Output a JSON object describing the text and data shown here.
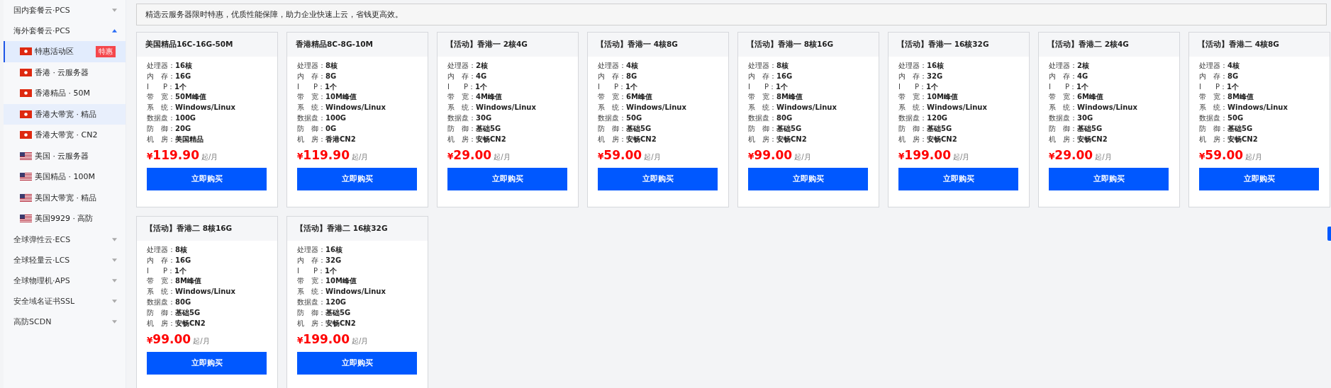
{
  "sidebar": {
    "groups": [
      {
        "label": "国内套餐云·PCS",
        "expanded": false
      },
      {
        "label": "海外套餐云·PCS",
        "expanded": true,
        "items": [
          {
            "label": "特惠活动区",
            "kind": "hk",
            "selected": true,
            "hovered": false,
            "badge": "特惠"
          },
          {
            "label": "香港 · 云服务器",
            "kind": "hk",
            "selected": false,
            "hovered": false
          },
          {
            "label": "香港精品 · 50M",
            "kind": "hk",
            "selected": false,
            "hovered": false
          },
          {
            "label": "香港大带宽 · 精品",
            "kind": "hk",
            "selected": false,
            "hovered": true
          },
          {
            "label": "香港大带宽 · CN2",
            "kind": "hk",
            "selected": false,
            "hovered": false
          },
          {
            "label": "美国 · 云服务器",
            "kind": "us",
            "selected": false,
            "hovered": false
          },
          {
            "label": "美国精品 · 100M",
            "kind": "us",
            "selected": false,
            "hovered": false
          },
          {
            "label": "美国大带宽 · 精品",
            "kind": "us",
            "selected": false,
            "hovered": false
          },
          {
            "label": "美国9929 · 高防",
            "kind": "us",
            "selected": false,
            "hovered": false
          }
        ]
      },
      {
        "label": "全球弹性云·ECS",
        "expanded": false
      },
      {
        "label": "全球轻量云·LCS",
        "expanded": false
      },
      {
        "label": "全球物理机·APS",
        "expanded": false
      },
      {
        "label": "安全域名证书SSL",
        "expanded": false
      },
      {
        "label": "高防SCDN",
        "expanded": false
      }
    ]
  },
  "notice": "精选云服务器限时特惠，优质性能保障，助力企业快速上云，省钱更高效。",
  "products": [
    {
      "title": "美国精品16C-16G-50M",
      "specs": [
        {
          "label": "处理器：",
          "value": "16核"
        },
        {
          "label": "内　存：",
          "value": "16G"
        },
        {
          "label": "I　　P：",
          "value": "1个"
        },
        {
          "label": "带　宽：",
          "value": "50M峰值"
        },
        {
          "label": "系　统：",
          "value": "Windows/Linux"
        },
        {
          "label": "数据盘：",
          "value": "100G"
        },
        {
          "label": "防　御：",
          "value": "20G"
        },
        {
          "label": "机　房：",
          "value": "美国精品"
        }
      ],
      "currency": "¥",
      "price": "119.90",
      "unit": "起/月",
      "button": "立即购买"
    },
    {
      "title": "香港精品8C-8G-10M",
      "specs": [
        {
          "label": "处理器：",
          "value": "8核"
        },
        {
          "label": "内　存：",
          "value": "8G"
        },
        {
          "label": "I　　P：",
          "value": "1个"
        },
        {
          "label": "带　宽：",
          "value": "10M峰值"
        },
        {
          "label": "系　统：",
          "value": "Windows/Linux"
        },
        {
          "label": "数据盘：",
          "value": "100G"
        },
        {
          "label": "防　御：",
          "value": "0G"
        },
        {
          "label": "机　房：",
          "value": "香港CN2"
        }
      ],
      "currency": "¥",
      "price": "119.90",
      "unit": "起/月",
      "button": "立即购买"
    },
    {
      "title": "【活动】香港一 2核4G",
      "specs": [
        {
          "label": "处理器：",
          "value": "2核"
        },
        {
          "label": "内　存：",
          "value": "4G"
        },
        {
          "label": "I　　P：",
          "value": "1个"
        },
        {
          "label": "带　宽：",
          "value": "4M峰值"
        },
        {
          "label": "系　统：",
          "value": "Windows/Linux"
        },
        {
          "label": "数据盘：",
          "value": "30G"
        },
        {
          "label": "防　御：",
          "value": "基础5G"
        },
        {
          "label": "机　房：",
          "value": "安畅CN2"
        }
      ],
      "currency": "¥",
      "price": "29.00",
      "unit": "起/月",
      "button": "立即购买"
    },
    {
      "title": "【活动】香港一 4核8G",
      "specs": [
        {
          "label": "处理器：",
          "value": "4核"
        },
        {
          "label": "内　存：",
          "value": "8G"
        },
        {
          "label": "I　　P：",
          "value": "1个"
        },
        {
          "label": "带　宽：",
          "value": "6M峰值"
        },
        {
          "label": "系　统：",
          "value": "Windows/Linux"
        },
        {
          "label": "数据盘：",
          "value": "50G"
        },
        {
          "label": "防　御：",
          "value": "基础5G"
        },
        {
          "label": "机　房：",
          "value": "安畅CN2"
        }
      ],
      "currency": "¥",
      "price": "59.00",
      "unit": "起/月",
      "button": "立即购买"
    },
    {
      "title": "【活动】香港一 8核16G",
      "specs": [
        {
          "label": "处理器：",
          "value": "8核"
        },
        {
          "label": "内　存：",
          "value": "16G"
        },
        {
          "label": "I　　P：",
          "value": "1个"
        },
        {
          "label": "带　宽：",
          "value": "8M峰值"
        },
        {
          "label": "系　统：",
          "value": "Windows/Linux"
        },
        {
          "label": "数据盘：",
          "value": "80G"
        },
        {
          "label": "防　御：",
          "value": "基础5G"
        },
        {
          "label": "机　房：",
          "value": "安畅CN2"
        }
      ],
      "currency": "¥",
      "price": "99.00",
      "unit": "起/月",
      "button": "立即购买"
    },
    {
      "title": "【活动】香港一 16核32G",
      "specs": [
        {
          "label": "处理器：",
          "value": "16核"
        },
        {
          "label": "内　存：",
          "value": "32G"
        },
        {
          "label": "I　　P：",
          "value": "1个"
        },
        {
          "label": "带　宽：",
          "value": "10M峰值"
        },
        {
          "label": "系　统：",
          "value": "Windows/Linux"
        },
        {
          "label": "数据盘：",
          "value": "120G"
        },
        {
          "label": "防　御：",
          "value": "基础5G"
        },
        {
          "label": "机　房：",
          "value": "安畅CN2"
        }
      ],
      "currency": "¥",
      "price": "199.00",
      "unit": "起/月",
      "button": "立即购买"
    },
    {
      "title": "【活动】香港二 2核4G",
      "specs": [
        {
          "label": "处理器：",
          "value": "2核"
        },
        {
          "label": "内　存：",
          "value": "4G"
        },
        {
          "label": "I　　P：",
          "value": "1个"
        },
        {
          "label": "带　宽：",
          "value": "6M峰值"
        },
        {
          "label": "系　统：",
          "value": "Windows/Linux"
        },
        {
          "label": "数据盘：",
          "value": "30G"
        },
        {
          "label": "防　御：",
          "value": "基础5G"
        },
        {
          "label": "机　房：",
          "value": "安畅CN2"
        }
      ],
      "currency": "¥",
      "price": "29.00",
      "unit": "起/月",
      "button": "立即购买"
    },
    {
      "title": "【活动】香港二 4核8G",
      "specs": [
        {
          "label": "处理器：",
          "value": "4核"
        },
        {
          "label": "内　存：",
          "value": "8G"
        },
        {
          "label": "I　　P：",
          "value": "1个"
        },
        {
          "label": "带　宽：",
          "value": "8M峰值"
        },
        {
          "label": "系　统：",
          "value": "Windows/Linux"
        },
        {
          "label": "数据盘：",
          "value": "50G"
        },
        {
          "label": "防　御：",
          "value": "基础5G"
        },
        {
          "label": "机　房：",
          "value": "安畅CN2"
        }
      ],
      "currency": "¥",
      "price": "59.00",
      "unit": "起/月",
      "button": "立即购买"
    },
    {
      "title": "【活动】香港二 8核16G",
      "specs": [
        {
          "label": "处理器：",
          "value": "8核"
        },
        {
          "label": "内　存：",
          "value": "16G"
        },
        {
          "label": "I　　P：",
          "value": "1个"
        },
        {
          "label": "带　宽：",
          "value": "8M峰值"
        },
        {
          "label": "系　统：",
          "value": "Windows/Linux"
        },
        {
          "label": "数据盘：",
          "value": "80G"
        },
        {
          "label": "防　御：",
          "value": "基础5G"
        },
        {
          "label": "机　房：",
          "value": "安畅CN2"
        }
      ],
      "currency": "¥",
      "price": "99.00",
      "unit": "起/月",
      "button": "立即购买"
    },
    {
      "title": "【活动】香港二 16核32G",
      "specs": [
        {
          "label": "处理器：",
          "value": "16核"
        },
        {
          "label": "内　存：",
          "value": "32G"
        },
        {
          "label": "I　　P：",
          "value": "1个"
        },
        {
          "label": "带　宽：",
          "value": "10M峰值"
        },
        {
          "label": "系　统：",
          "value": "Windows/Linux"
        },
        {
          "label": "数据盘：",
          "value": "120G"
        },
        {
          "label": "防　御：",
          "value": "基础5G"
        },
        {
          "label": "机　房：",
          "value": "安畅CN2"
        }
      ],
      "currency": "¥",
      "price": "199.00",
      "unit": "起/月",
      "button": "立即购买"
    }
  ]
}
